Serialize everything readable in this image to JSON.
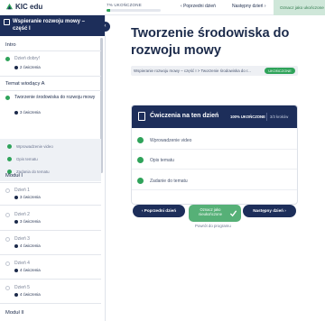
{
  "topbar": {
    "logo": "KIC edu",
    "progress_label": "7% UKOŃCZONE",
    "progress_fraction": 0.07,
    "prev_label": "Poprzedni dzień",
    "next_label": "Następny dzień",
    "mark_done_label": "Oznacz jako ukończone"
  },
  "sidebar": {
    "title": "Wspieranie rozwoju mowy – część I",
    "sections": [
      {
        "label": "Intro"
      },
      {
        "label": "Temat wiodący A"
      },
      {
        "label": "Moduł I"
      },
      {
        "label": "Moduł II"
      }
    ],
    "items": [
      {
        "title": "Dzień dobry!",
        "count": "2 ćwiczenia"
      },
      {
        "title": "Tworzenie środowiska do rozwoju mowy",
        "count": "3 ćwiczenia"
      },
      {
        "title": "Dzień 1",
        "count": "3 ćwiczenia"
      },
      {
        "title": "Dzień 2",
        "count": "3 ćwiczenia"
      },
      {
        "title": "Dzień 3",
        "count": "4 ćwiczenia"
      },
      {
        "title": "Dzień 4",
        "count": "4 ćwiczenia"
      },
      {
        "title": "Dzień 5",
        "count": "4 ćwiczenia"
      }
    ],
    "subitems": [
      "Wprowadzenie video",
      "Opis tematu",
      "Zadania do tematu"
    ]
  },
  "main": {
    "title": "Tworzenie środowiska do rozwoju mowy",
    "breadcrumb": "Wspieranie rozwoju mowy – część I > Tworzenie środowiska do r...",
    "badge": "UKOŃCZONE",
    "card": {
      "title": "Ćwiczenia na ten dzień",
      "percent": "100% UKOŃCZONE",
      "count": "3/3 kroków",
      "exercises": [
        "Wprowadzenie video",
        "Opis tematu",
        "Zadanie do tematu"
      ]
    },
    "buttons": {
      "prev": "Poprzedni dzień",
      "done": "Oznacz jako nieukończone",
      "next": "Następny dzień",
      "back": "Powrót do programu"
    }
  },
  "colors": {
    "navy": "#1d2e5a",
    "green": "#2fa35a",
    "light_green": "#cfe7d9"
  }
}
